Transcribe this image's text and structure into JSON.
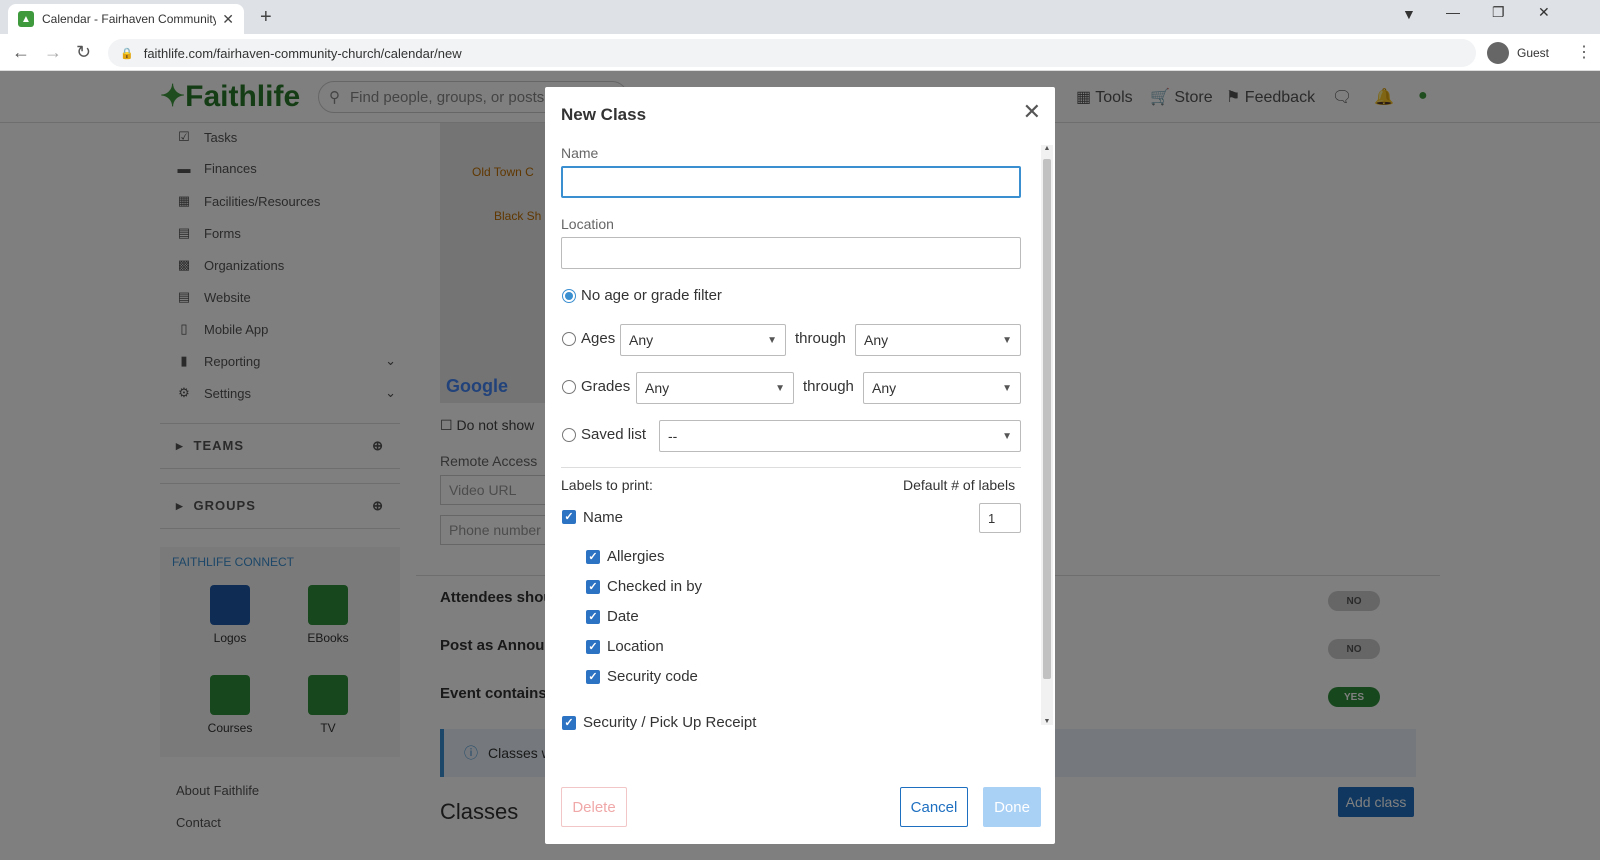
{
  "browser": {
    "tab_title": "Calendar - Fairhaven Community",
    "url": "faithlife.com/fairhaven-community-church/calendar/new",
    "profile_label": "Guest"
  },
  "header": {
    "logo": "Faithlife",
    "search_placeholder": "Find people, groups, or posts",
    "tools_label": "Tools",
    "store_label": "Store",
    "feedback_label": "Feedback"
  },
  "sidebar": {
    "items": [
      {
        "label": "Tasks",
        "icon": "tasks-icon"
      },
      {
        "label": "Finances",
        "icon": "finances-icon"
      },
      {
        "label": "Facilities/Resources",
        "icon": "facilities-icon"
      },
      {
        "label": "Forms",
        "icon": "forms-icon"
      },
      {
        "label": "Organizations",
        "icon": "organizations-icon"
      },
      {
        "label": "Website",
        "icon": "website-icon"
      },
      {
        "label": "Mobile App",
        "icon": "mobile-icon"
      },
      {
        "label": "Reporting",
        "icon": "reporting-icon"
      },
      {
        "label": "Settings",
        "icon": "gear-icon"
      }
    ],
    "teams_label": "TEAMS",
    "groups_label": "GROUPS",
    "connect_label": "FAITHLIFE CONNECT",
    "apps": [
      {
        "label": "Logos",
        "color": "#1e5aa8"
      },
      {
        "label": "EBooks",
        "color": "#2f8f3a"
      },
      {
        "label": "Courses",
        "color": "#2f8f3a"
      },
      {
        "label": "TV",
        "color": "#2f8f3a"
      }
    ],
    "footer_links": [
      "About Faithlife",
      "Contact"
    ]
  },
  "main": {
    "map_labels": [
      "Old Town C",
      "Black Sh"
    ],
    "map_brand": "Google",
    "do_not_show_label": "Do not show",
    "remote_access_label": "Remote Access",
    "video_url_placeholder": "Video URL",
    "phone_placeholder": "Phone number",
    "rows": [
      {
        "label": "Attendees shou",
        "toggle": "NO"
      },
      {
        "label": "Post as Announ",
        "toggle": "NO"
      },
      {
        "label": "Event contains",
        "toggle": "YES"
      }
    ],
    "info_text": "Classes w",
    "classes_title": "Classes",
    "add_class_label": "Add class"
  },
  "modal": {
    "title": "New Class",
    "name_label": "Name",
    "name_value": "",
    "location_label": "Location",
    "location_value": "",
    "filters": {
      "none_label": "No age or grade filter",
      "ages_label": "Ages",
      "ages_from": "Any",
      "ages_to": "Any",
      "grades_label": "Grades",
      "grades_from": "Any",
      "grades_to": "Any",
      "through_label": "through",
      "saved_list_label": "Saved list",
      "saved_list_value": "--",
      "selected": "none"
    },
    "labels_to_print": "Labels to print:",
    "default_count_label": "Default # of labels",
    "name_checkbox_label": "Name",
    "default_count": "1",
    "sub_labels": [
      "Allergies",
      "Checked in by",
      "Date",
      "Location",
      "Security code"
    ],
    "receipt_label": "Security / Pick Up Receipt",
    "delete_label": "Delete",
    "cancel_label": "Cancel",
    "done_label": "Done"
  }
}
